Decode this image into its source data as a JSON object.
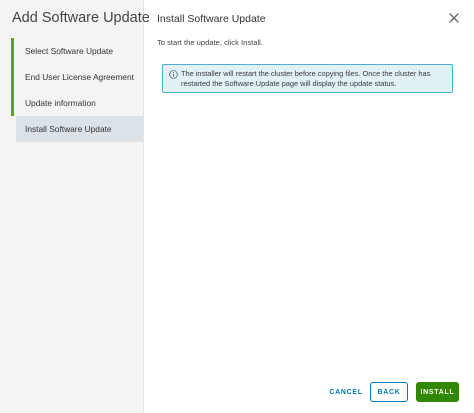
{
  "wizard": {
    "title": "Add Software Update",
    "steps": [
      {
        "label": "Select Software Update"
      },
      {
        "label": "End User License Agreement"
      },
      {
        "label": "Update information"
      },
      {
        "label": "Install Software Update"
      }
    ]
  },
  "page": {
    "title": "Install Software Update",
    "intro": "To start the update, click Install.",
    "alert": {
      "icon": "info-circle-icon",
      "text": "The installer will restart the cluster before copying files. Once the cluster has restarted the Software Update page will display the update status."
    }
  },
  "footer": {
    "cancel_label": "CANCEL",
    "back_label": "BACK",
    "install_label": "INSTALL"
  },
  "colors": {
    "step_complete": "#5aa220",
    "step_active_bg": "#dbe3e9",
    "alert_bg": "#e1f1f6",
    "alert_border": "#49afd9",
    "link_blue": "#0079b8",
    "primary_green": "#318700"
  }
}
